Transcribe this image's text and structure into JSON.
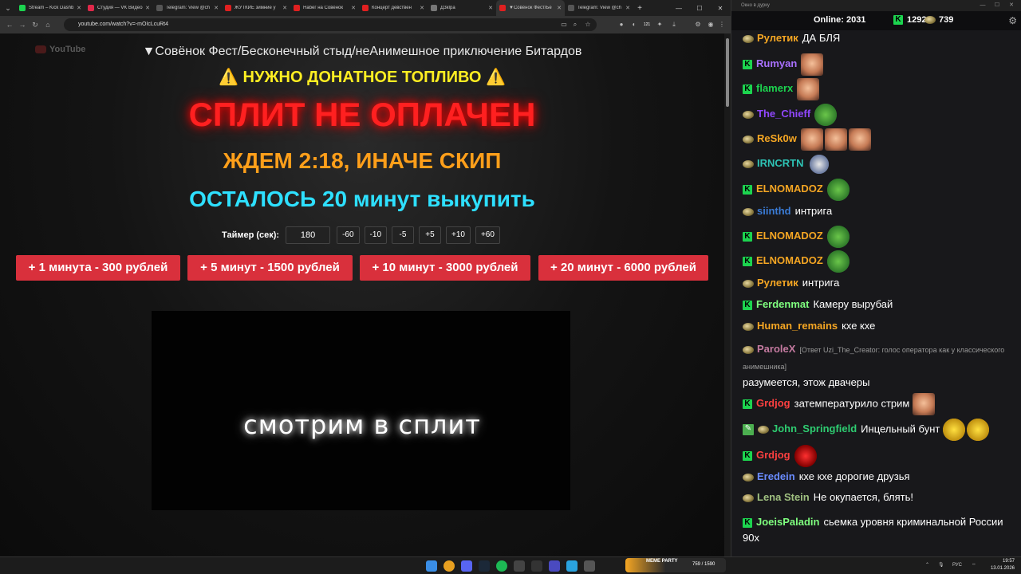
{
  "browser": {
    "tabs": [
      {
        "title": "Stream – Kick Dashb",
        "color": "#1cd44f"
      },
      {
        "title": "Студия — VK Видео",
        "color": "#e0284a"
      },
      {
        "title": "Telegram: View @ch",
        "color": "#555555"
      },
      {
        "title": "ЖУТКИЕ зимние у",
        "color": "#e02020"
      },
      {
        "title": "Набег на Совёнок",
        "color": "#e02020"
      },
      {
        "title": "Концерт девствен",
        "color": "#e02020"
      },
      {
        "title": "ДЗкIра",
        "color": "#777777"
      },
      {
        "title": "▼Совёнок Фест/Бе",
        "color": "#e02020"
      },
      {
        "title": "Telegram: View @ch",
        "color": "#555555"
      }
    ],
    "url": "youtube.com/watch?v=-mOIcLcuRt4",
    "badge_count": "121"
  },
  "video": {
    "yt_logo": "YouTube",
    "title": "▼Совёнок Фест/Бесконечный стыд/неАнимешное приключение Битардов",
    "fuel": "⚠️ НУЖНО ДОНАТНОЕ ТОПЛИВО ⚠️",
    "unpaid": "СПЛИТ НЕ ОПЛАЧЕН",
    "wait": "ЖДЕМ 2:18, ИНАЧЕ СКИП",
    "left": "ОСТАЛОСЬ 20 минут выкупить",
    "timer_label": "Таймер (сек):",
    "timer_value": "180",
    "timer_buttons": [
      "-60",
      "-10",
      "-5",
      "+5",
      "+10",
      "+60"
    ],
    "donate_buttons": [
      "+ 1 минута - 300 рублей",
      "+ 5 минут - 1500 рублей",
      "+ 10 минут - 3000 рублей",
      "+ 20 минут - 6000 рублей"
    ],
    "overlay": "смотрим в сплит"
  },
  "chat": {
    "window_title": "Окно в дурку",
    "online_label": "Online:",
    "online_count": "2031",
    "kick_count": "1292",
    "other_count": "739",
    "messages": [
      {
        "badge": "p",
        "user": "Рулетик",
        "color": "#f5a623",
        "text": "ДА БЛЯ"
      },
      {
        "badge": "k",
        "user": "Rumyan",
        "color": "#a970ff",
        "text": "",
        "emotes": [
          "face"
        ]
      },
      {
        "badge": "k",
        "user": "flamerx",
        "color": "#1cd44f",
        "text": "",
        "emotes": [
          "face"
        ]
      },
      {
        "badge": "p",
        "user": "The_Chieff",
        "color": "#9147ff",
        "text": "",
        "emotes": [
          "frog"
        ]
      },
      {
        "badge": "p",
        "user": "ReSk0w",
        "color": "#f5a623",
        "text": "",
        "emotes": [
          "face",
          "face",
          "face"
        ]
      },
      {
        "badge": "p",
        "user": "IRNCRTN",
        "color": "#2ec4b6",
        "text": "",
        "emotes": [
          "snoo"
        ]
      },
      {
        "badge": "k",
        "user": "ELNOMADOZ",
        "color": "#f5a623",
        "text": "",
        "emotes": [
          "frog"
        ]
      },
      {
        "badge": "p",
        "user": "siinthd",
        "color": "#3a7bd5",
        "text": "интрига"
      },
      {
        "badge": "k",
        "user": "ELNOMADOZ",
        "color": "#f5a623",
        "text": "",
        "emotes": [
          "frog"
        ]
      },
      {
        "badge": "k",
        "user": "ELNOMADOZ",
        "color": "#f5a623",
        "text": "",
        "emotes": [
          "frog"
        ]
      },
      {
        "badge": "p",
        "user": "Рулетик",
        "color": "#f5a623",
        "text": "интрига"
      },
      {
        "badge": "k",
        "user": "Ferdenmat",
        "color": "#7fff7f",
        "text": "Камеру вырубай"
      },
      {
        "badge": "p",
        "user": "Human_remains",
        "color": "#f5a623",
        "text": "кхе кхе"
      },
      {
        "badge": "p",
        "user": "ParoleX",
        "color": "#c47aa0",
        "sub": "[Ответ Uzi_The_Creator: голос оператора как у классического анимешника]",
        "text": "разумеется, этож двачеры"
      },
      {
        "badge": "k",
        "user": "Grdjog",
        "color": "#ff4040",
        "text": "затемпературило стрим",
        "emotes": [
          "face"
        ]
      },
      {
        "badge": "p",
        "user": "John_Springfield",
        "color": "#2ecc71",
        "text": "Инцельный бунт",
        "emotes": [
          "yell",
          "yell"
        ],
        "extra": "pencil"
      },
      {
        "badge": "k",
        "user": "Grdjog",
        "color": "#ff4040",
        "text": "",
        "emotes": [
          "red"
        ]
      },
      {
        "badge": "p",
        "user": "Eredein",
        "color": "#6a8cff",
        "text": "кхе кхе дорогие друзья"
      },
      {
        "badge": "p",
        "user": "Lena Stein",
        "color": "#a0c080",
        "text": "Не окупается, блять!"
      },
      {
        "badge": "k",
        "user": "JoeisPaladin",
        "color": "#7fff7f",
        "text": "сьемка уровня криминальной России 90х"
      }
    ]
  },
  "taskbar": {
    "meme_title": "MEME PARTY",
    "meme_count": "759 / 1590",
    "lang": "РУС",
    "time": "19:57",
    "date": "13.01.2026"
  }
}
